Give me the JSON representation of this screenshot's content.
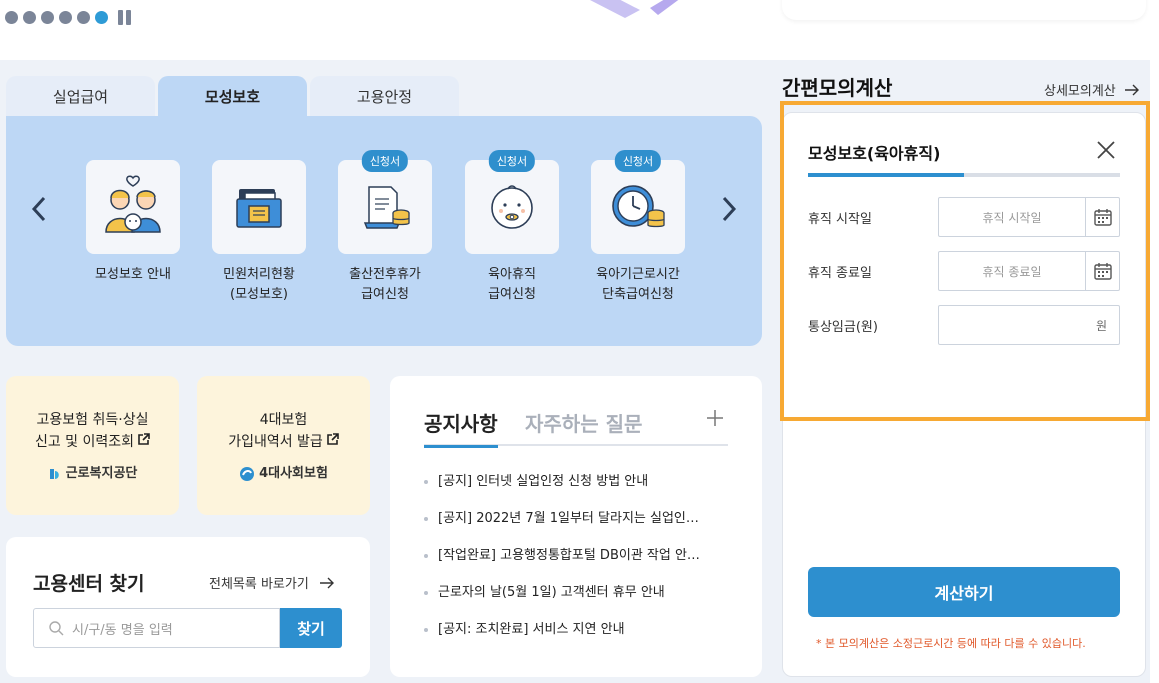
{
  "slider": {
    "dot_count": 6,
    "active_index": 5
  },
  "tabs": [
    {
      "label": "실업급여",
      "active": false
    },
    {
      "label": "모성보호",
      "active": true
    },
    {
      "label": "고용안정",
      "active": false
    }
  ],
  "services": [
    {
      "label_line1": "모성보호 안내",
      "label_line2": "",
      "badge": "",
      "icon": "family-icon"
    },
    {
      "label_line1": "민원처리현황",
      "label_line2": "(모성보호)",
      "badge": "",
      "icon": "folder-document-icon"
    },
    {
      "label_line1": "출산전후휴가",
      "label_line2": "급여신청",
      "badge": "신청서",
      "icon": "document-coins-icon"
    },
    {
      "label_line1": "육아휴직",
      "label_line2": "급여신청",
      "badge": "신청서",
      "icon": "baby-icon"
    },
    {
      "label_line1": "육아기근로시간",
      "label_line2": "단축급여신청",
      "badge": "신청서",
      "icon": "clock-coins-icon"
    }
  ],
  "shortcuts": [
    {
      "line1": "고용보험 취득·상실",
      "line2": "신고 및 이력조회",
      "org": "근로복지공단"
    },
    {
      "line1": "4대보험",
      "line2": "가입내역서 발급",
      "org": "4대사회보험"
    }
  ],
  "finder": {
    "title": "고용센터 찾기",
    "link": "전체목록 바로가기",
    "placeholder": "시/구/동 명을 입력",
    "button": "찾기"
  },
  "notice": {
    "tab_active": "공지사항",
    "tab_inactive": "자주하는 질문",
    "items": [
      "[공지] 인터넷 실업인정 신청 방법 안내",
      "[공지] 2022년 7월 1일부터 달라지는 실업인…",
      "[작업완료] 고용행정통합포털 DB이관 작업 안…",
      "근로자의 날(5월 1일) 고객센터 휴무 안내",
      "[공지: 조치완료] 서비스 지연 안내"
    ]
  },
  "calculator": {
    "title": "간편모의계산",
    "detail_link": "상세모의계산",
    "subtitle": "모성보호(육아휴직)",
    "progress": 0.5,
    "start_label": "휴직 시작일",
    "start_placeholder": "휴직 시작일",
    "end_label": "휴직 종료일",
    "end_placeholder": "휴직 종료일",
    "wage_label": "통상임금(원)",
    "wage_unit": "원",
    "button": "계산하기",
    "note": "* 본 모의계산은 소정근로시간 등에 따라 다를 수 있습니다."
  },
  "colors": {
    "accent": "#2d8fcf",
    "tab_panel": "#bdd7f5",
    "highlight": "#f7a933",
    "shortcut_bg": "#fdf4dc"
  }
}
